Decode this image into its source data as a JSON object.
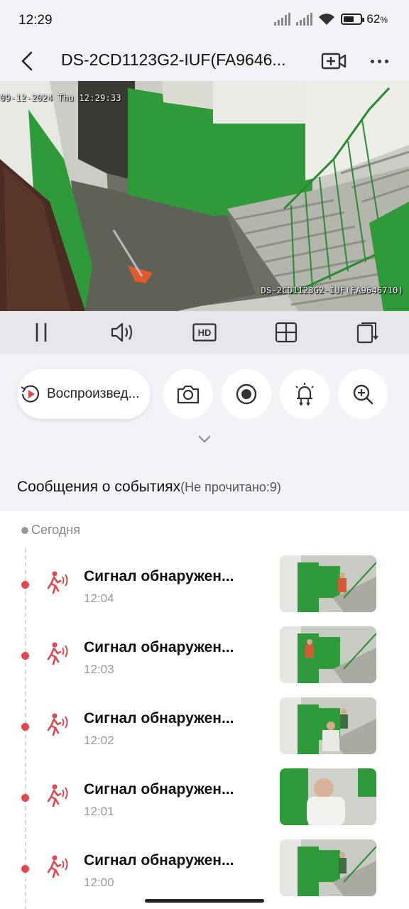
{
  "status_bar": {
    "time": "12:29",
    "battery_percent": "62",
    "battery_suffix": "%"
  },
  "header": {
    "title": "DS-2CD1123G2-IUF(FA9646...",
    "back_icon": "chevron-left-icon",
    "add_video_icon": "video-plus-icon",
    "more_icon": "more-dots-icon"
  },
  "video": {
    "osd_timestamp": "09-12-2024 Thu 12:29:33",
    "osd_camera_name": "DS-2CD1123G2-IUF(FA9646710)"
  },
  "controls": [
    {
      "name": "pause",
      "icon": "pause-icon"
    },
    {
      "name": "sound",
      "icon": "speaker-icon"
    },
    {
      "name": "quality",
      "icon": "hd-icon",
      "label": "HD"
    },
    {
      "name": "layout",
      "icon": "grid-icon"
    },
    {
      "name": "fullscreen",
      "icon": "rotate-screen-icon"
    }
  ],
  "actions": {
    "playback_label": "Воспроизвед...",
    "playback_icon": "playback-icon",
    "snapshot_icon": "camera-icon",
    "record_icon": "record-icon",
    "alarm_icon": "alarm-light-icon",
    "zoom_icon": "zoom-in-icon"
  },
  "events_section": {
    "title": "Сообщения о событиях",
    "unread": "(Не прочитано:9)"
  },
  "event_list": {
    "day_label": "Сегодня",
    "items": [
      {
        "title": "Сигнал обнаружен...",
        "time": "12:04"
      },
      {
        "title": "Сигнал обнаружен...",
        "time": "12:03"
      },
      {
        "title": "Сигнал обнаружен...",
        "time": "12:02"
      },
      {
        "title": "Сигнал обнаружен...",
        "time": "12:01"
      },
      {
        "title": "Сигнал обнаружен...",
        "time": "12:00"
      }
    ]
  },
  "colors": {
    "accent_red": "#e4464f",
    "background": "#f3f3f7",
    "wall_green": "#2f9a3a"
  }
}
